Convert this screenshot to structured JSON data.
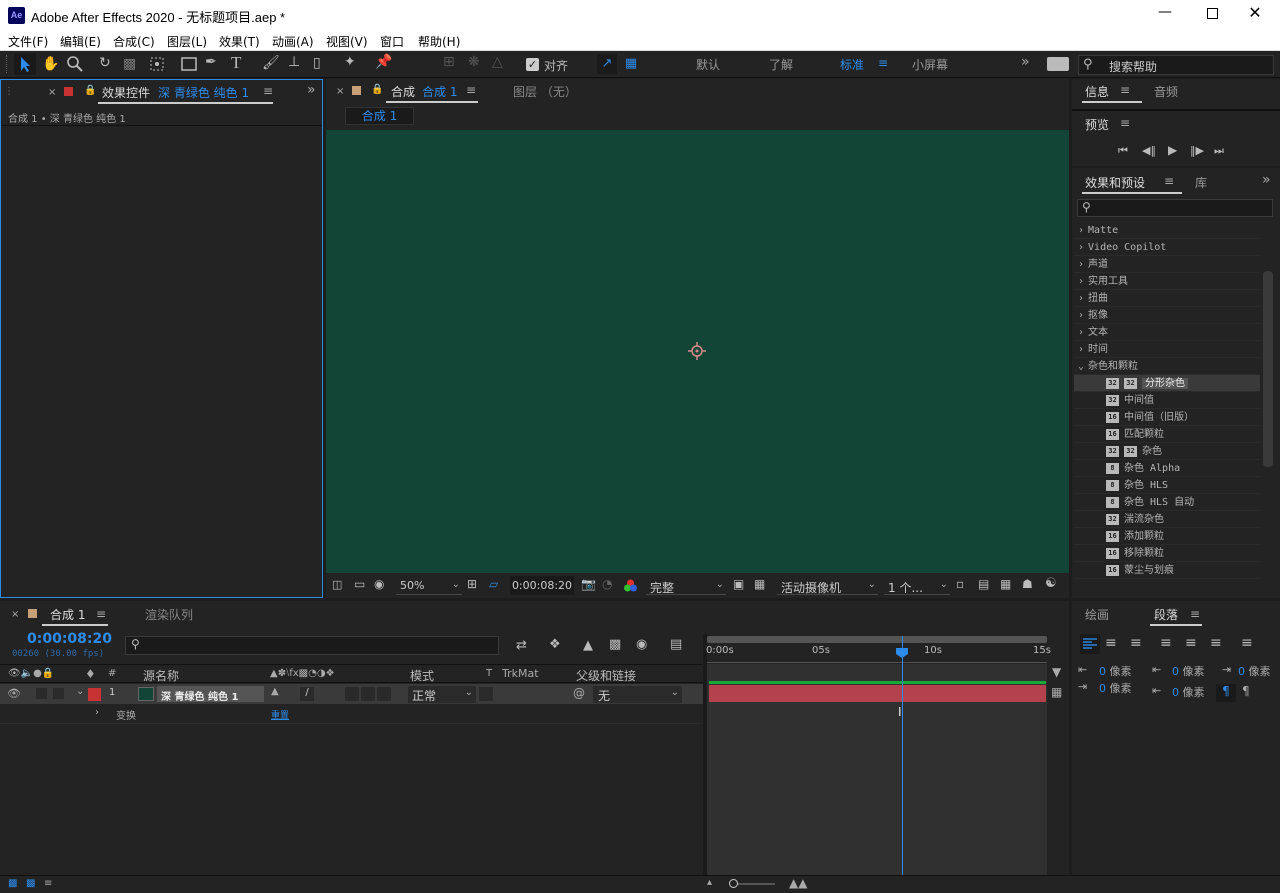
{
  "app": {
    "title": "Adobe After Effects 2020 - 无标题项目.aep *",
    "logo": "Ae"
  },
  "menu": [
    "文件(F)",
    "编辑(E)",
    "合成(C)",
    "图层(L)",
    "效果(T)",
    "动画(A)",
    "视图(V)",
    "窗口",
    "帮助(H)"
  ],
  "toolbar": {
    "snap_label": "对齐",
    "workspaces": [
      "默认",
      "了解",
      "标准",
      "小屏幕"
    ],
    "active_workspace": "标准",
    "search_placeholder": "搜索帮助"
  },
  "effect_controls": {
    "tab_label": "效果控件",
    "tab_layer": "深 青绿色 纯色 1",
    "breadcrumb": "合成 1 • 深 青绿色 纯色 1"
  },
  "comp_panel": {
    "tab_label": "合成",
    "tab_comp": "合成 1",
    "layer_tab": "图层 （无）",
    "subtab": "合成 1",
    "bg_color": "#124536",
    "zoom": "50%",
    "timecode": "0:00:08:20",
    "resolution": "完整",
    "camera": "活动摄像机",
    "views": "1 个..."
  },
  "info_panel": {
    "tabs": [
      "信息",
      "音频"
    ],
    "preview_label": "预览"
  },
  "effects_presets": {
    "tabs": [
      "效果和预设",
      "库"
    ],
    "categories": [
      "Matte",
      "Video Copilot",
      "声道",
      "实用工具",
      "扭曲",
      "抠像",
      "文本",
      "时间",
      "杂色和颗粒"
    ],
    "items": [
      {
        "badges": [
          "32",
          "32"
        ],
        "label": "分形杂色",
        "selected": true
      },
      {
        "badges": [
          "32"
        ],
        "label": "中间值"
      },
      {
        "badges": [
          "16"
        ],
        "label": "中间值（旧版）"
      },
      {
        "badges": [
          "16"
        ],
        "label": "匹配颗粒"
      },
      {
        "badges": [
          "32",
          "32"
        ],
        "label": "杂色"
      },
      {
        "badges": [
          "8"
        ],
        "label": "杂色 Alpha"
      },
      {
        "badges": [
          "8"
        ],
        "label": "杂色 HLS"
      },
      {
        "badges": [
          "8"
        ],
        "label": "杂色 HLS 自动"
      },
      {
        "badges": [
          "32"
        ],
        "label": "湍流杂色"
      },
      {
        "badges": [
          "16"
        ],
        "label": "添加颗粒"
      },
      {
        "badges": [
          "16"
        ],
        "label": "移除颗粒"
      },
      {
        "badges": [
          "16"
        ],
        "label": "蒙尘与划痕"
      }
    ]
  },
  "timeline": {
    "tab_label": "合成 1",
    "render_tab": "渲染队列",
    "timecode": "0:00:08:20",
    "frames": "00260 (30.00 fps)",
    "col_source": "源名称",
    "col_mode": "模式",
    "col_t": "T",
    "col_trkmat": "TrkMat",
    "col_parent": "父级和链接",
    "layer": {
      "num": "1",
      "name": "深 青绿色 纯色 1",
      "mode": "正常",
      "parent": "无",
      "label_color": "#c83232"
    },
    "transform": "变换",
    "reset": "重置",
    "ruler": [
      "0:00s",
      "05s",
      "10s",
      "15s"
    ],
    "playhead_fraction": 0.58,
    "duration_s": 15,
    "current_s": 8.67
  },
  "paragraph": {
    "tabs": [
      "绘画",
      "段落"
    ],
    "unit": "像素",
    "values": [
      "0",
      "0",
      "0",
      "0",
      "0"
    ]
  }
}
